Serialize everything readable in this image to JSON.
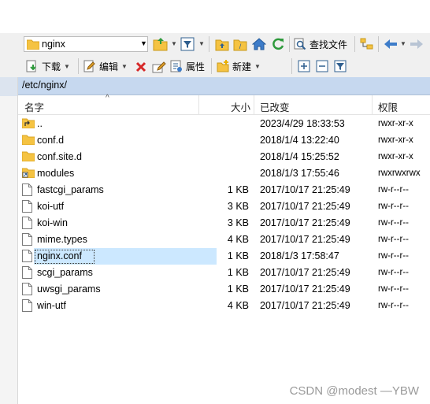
{
  "path_combo": {
    "value": "nginx"
  },
  "toolbar2": {
    "download_label": "下载",
    "edit_label": "编辑",
    "properties_label": "属性",
    "new_label": "新建"
  },
  "toolbar1": {
    "find_files_label": "查找文件"
  },
  "path_bar": {
    "path": "/etc/nginx/"
  },
  "columns": {
    "name": "名字",
    "size": "大小",
    "modified": "已改变",
    "permissions": "权限"
  },
  "rows": [
    {
      "name": "..",
      "size": "",
      "modified": "2023/4/29 18:33:53",
      "permissions": "rwxr-xr-x",
      "icon": "parent-folder-icon"
    },
    {
      "name": "conf.d",
      "size": "",
      "modified": "2018/1/4 13:22:40",
      "permissions": "rwxr-xr-x",
      "icon": "folder-icon"
    },
    {
      "name": "conf.site.d",
      "size": "",
      "modified": "2018/1/4 15:25:52",
      "permissions": "rwxr-xr-x",
      "icon": "folder-icon"
    },
    {
      "name": "modules",
      "size": "",
      "modified": "2018/1/3 17:55:46",
      "permissions": "rwxrwxrwx",
      "icon": "folder-link-icon"
    },
    {
      "name": "fastcgi_params",
      "size": "1 KB",
      "modified": "2017/10/17 21:25:49",
      "permissions": "rw-r--r--",
      "icon": "file-icon"
    },
    {
      "name": "koi-utf",
      "size": "3 KB",
      "modified": "2017/10/17 21:25:49",
      "permissions": "rw-r--r--",
      "icon": "file-icon"
    },
    {
      "name": "koi-win",
      "size": "3 KB",
      "modified": "2017/10/17 21:25:49",
      "permissions": "rw-r--r--",
      "icon": "file-icon"
    },
    {
      "name": "mime.types",
      "size": "4 KB",
      "modified": "2017/10/17 21:25:49",
      "permissions": "rw-r--r--",
      "icon": "file-icon"
    },
    {
      "name": "nginx.conf",
      "size": "1 KB",
      "modified": "2018/1/3 17:58:47",
      "permissions": "rw-r--r--",
      "icon": "file-icon",
      "selected": true
    },
    {
      "name": "scgi_params",
      "size": "1 KB",
      "modified": "2017/10/17 21:25:49",
      "permissions": "rw-r--r--",
      "icon": "file-icon"
    },
    {
      "name": "uwsgi_params",
      "size": "1 KB",
      "modified": "2017/10/17 21:25:49",
      "permissions": "rw-r--r--",
      "icon": "file-icon"
    },
    {
      "name": "win-utf",
      "size": "4 KB",
      "modified": "2017/10/17 21:25:49",
      "permissions": "rw-r--r--",
      "icon": "file-icon"
    }
  ],
  "watermark": "CSDN @modest —YBW",
  "colors": {
    "path_bar": "#c6d8ef",
    "selected_row": "#cce8ff",
    "folder": "#f5c342"
  }
}
